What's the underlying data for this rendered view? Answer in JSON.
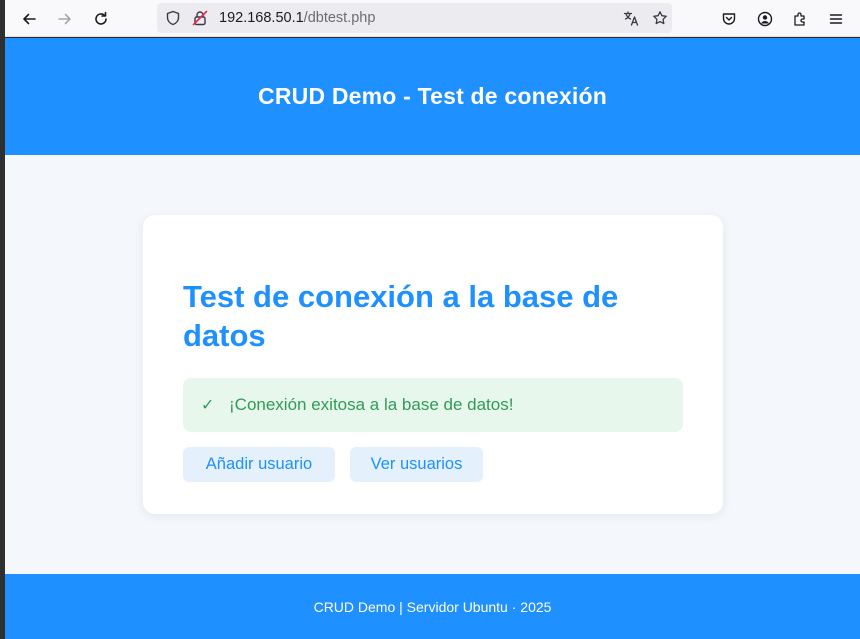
{
  "browser": {
    "url_host": "192.168.50.1",
    "url_path": "/dbtest.php"
  },
  "page": {
    "header_title": "CRUD Demo - Test de conexión",
    "card_title": "Test de conexión a la base de datos",
    "alert_message": "¡Conexión exitosa a la base de datos!",
    "buttons": {
      "add_user": "Añadir usuario",
      "view_users": "Ver usuarios"
    },
    "footer_text": "CRUD Demo | Servidor Ubuntu · 2025"
  },
  "colors": {
    "primary": "#1e90ff",
    "success": "#2e9b57",
    "success_bg": "#e8f7ec",
    "page_bg": "#f4f7fb"
  },
  "icons": [
    "back-arrow-icon",
    "forward-arrow-icon",
    "reload-icon",
    "shield-icon",
    "insecure-lock-icon",
    "translate-icon",
    "bookmark-star-icon",
    "pocket-icon",
    "account-icon",
    "extensions-icon",
    "menu-icon",
    "check-icon"
  ]
}
